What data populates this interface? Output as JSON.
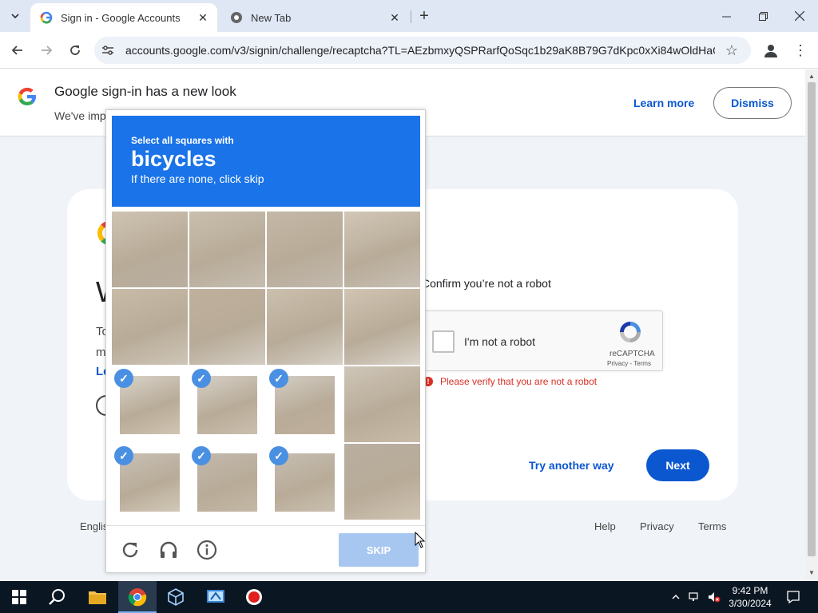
{
  "browser": {
    "tabs": [
      {
        "title": "Sign in - Google Accounts",
        "active": true
      },
      {
        "title": "New Tab",
        "active": false
      }
    ],
    "url": "accounts.google.com/v3/signin/challenge/recaptcha?TL=AEzbmxyQSPRarfQoSqc1b29aK8B79G7dKpc0xXi84wOldHaG..."
  },
  "banner": {
    "title": "Google sign-in has a new look",
    "subtitle": "We've imp",
    "learn_more": "Learn more",
    "dismiss": "Dismiss"
  },
  "card": {
    "heading_fragment": "W",
    "frag1": "To",
    "frag2": "m",
    "frag3": "Le",
    "confirm_text": "Confirm you’re not a robot",
    "recaptcha": {
      "label": "I'm not a robot",
      "brand": "reCAPTCHA",
      "links": "Privacy - Terms",
      "error": "Please verify that you are not a robot"
    },
    "try_another": "Try another way",
    "next": "Next"
  },
  "footer": {
    "language": "Englis",
    "help": "Help",
    "privacy": "Privacy",
    "terms": "Terms"
  },
  "challenge": {
    "line1": "Select all squares with",
    "object": "bicycles",
    "line3": "If there are none, click skip",
    "tiles_selected": [
      false,
      false,
      false,
      false,
      false,
      false,
      false,
      false,
      true,
      true,
      true,
      false,
      true,
      true,
      true,
      false
    ],
    "skip": "SKIP"
  },
  "taskbar": {
    "time": "9:42 PM",
    "date": "3/30/2024"
  },
  "colors": {
    "accent": "#0b57d0",
    "challenge_header": "#1a73e8",
    "error": "#d93025",
    "taskbar": "#0b1623"
  }
}
